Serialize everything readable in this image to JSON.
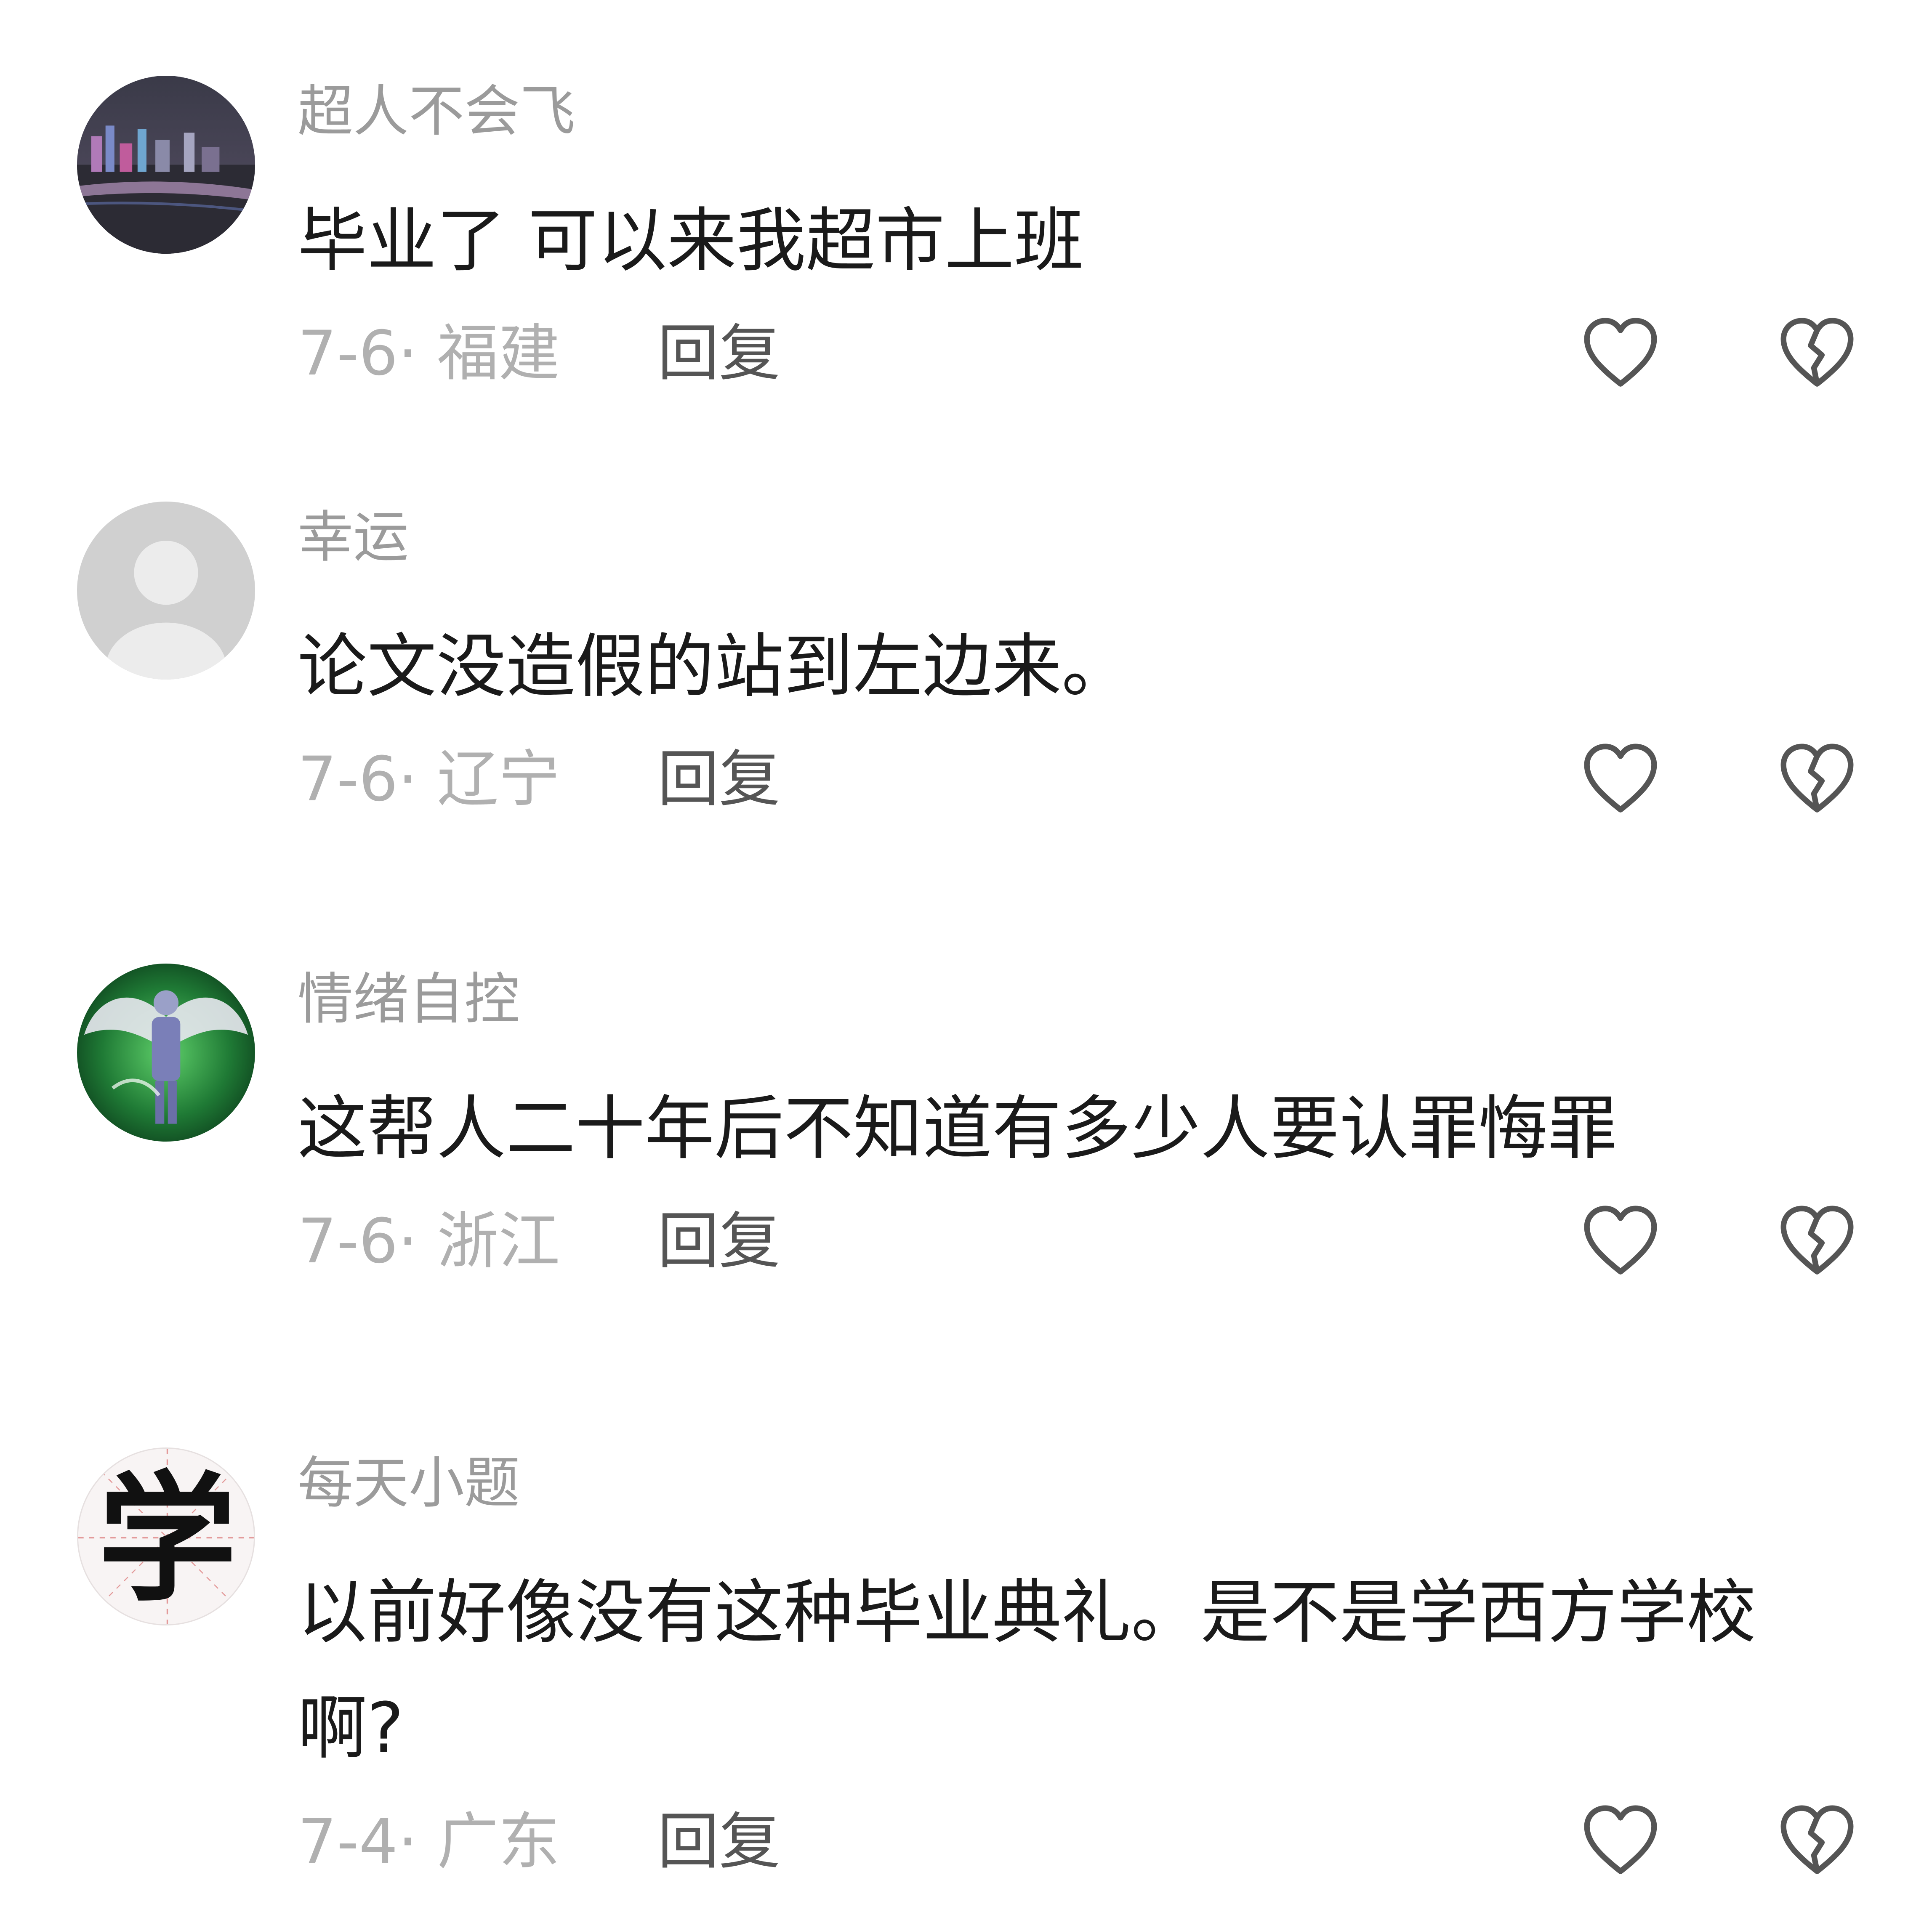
{
  "comments": [
    {
      "username": "超人不会飞",
      "text": "毕业了 可以来我超市上班",
      "date_location": "7-6· 福建",
      "reply_label": "回复",
      "avatar_icon": "city-night-avatar"
    },
    {
      "username": "幸运",
      "text": "论文没造假的站到左边来。",
      "date_location": "7-6· 辽宁",
      "reply_label": "回复",
      "avatar_icon": "default-user-avatar"
    },
    {
      "username": "情绪自控",
      "text": "这帮人二十年后不知道有多少人要认罪悔罪",
      "date_location": "7-6· 浙江",
      "reply_label": "回复",
      "avatar_icon": "winged-figure-avatar"
    },
    {
      "username": "每天小题",
      "text": "以前好像没有这种毕业典礼。是不是学西方学校啊?",
      "date_location": "7-4· 广东",
      "reply_label": "回复",
      "avatar_icon": "xue-character-avatar",
      "avatar_text": "学"
    }
  ],
  "icons": {
    "like": "heart-outline-icon",
    "dislike": "broken-heart-icon"
  },
  "colors": {
    "username": "#9b9b9b",
    "body_text": "#1a1a1a",
    "meta_text": "#b0b0b0",
    "reply_text": "#555555",
    "icon_stroke": "#555555"
  }
}
